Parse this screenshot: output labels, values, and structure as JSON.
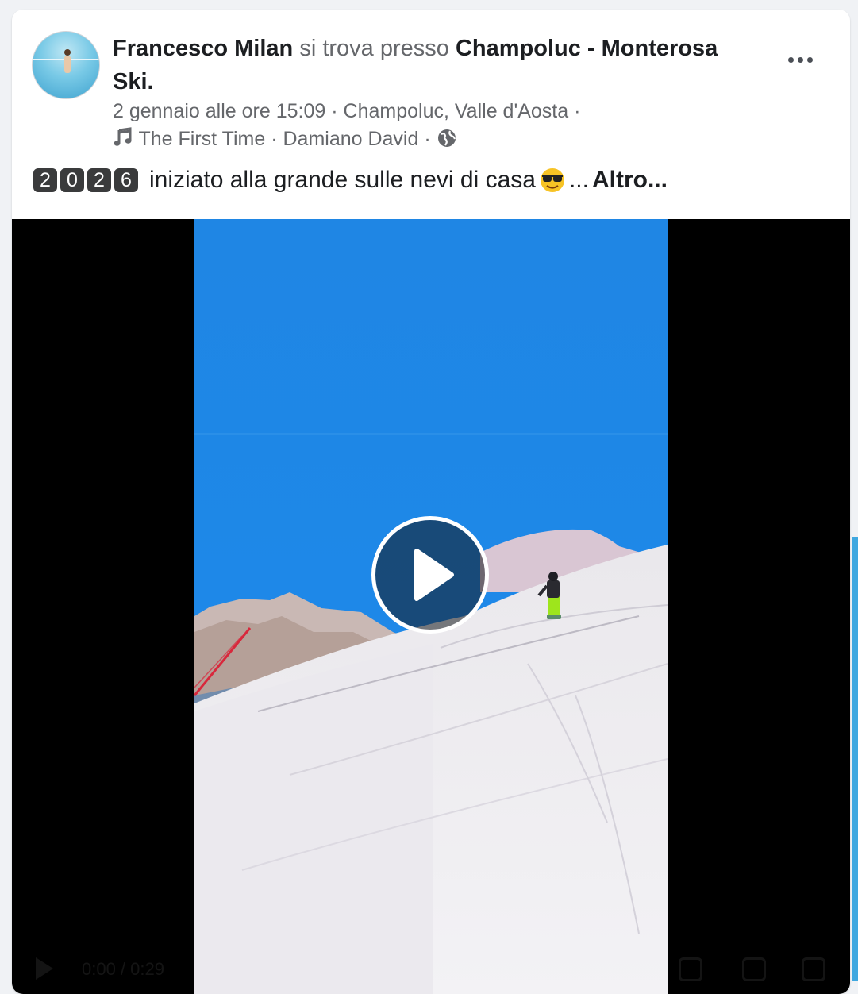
{
  "post": {
    "author_name": "Francesco Milan",
    "checkin_text": "si trova presso",
    "place_name": "Champoluc - Monterosa Ski.",
    "date": "2 gennaio alle ore 15:09",
    "separator": "·",
    "location": "Champoluc, Valle d'Aosta",
    "song_title": "The First Time",
    "song_artist": "Damiano David",
    "privacy_icon": "globe-icon",
    "more_icon": "more-options-icon",
    "caption": {
      "year_digits": [
        "2",
        "0",
        "2",
        "6"
      ],
      "text": "iniziato alla grande sulle nevi di casa",
      "emoji": "smiling-face-with-sunglasses",
      "ellipsis": "...",
      "more_link": "Altro..."
    }
  },
  "video": {
    "play_icon": "play-icon",
    "time": "0:00 / 0:29"
  },
  "colors": {
    "background": "#f0f2f5",
    "card": "#ffffff",
    "primary_text": "#1c1e21",
    "secondary_text": "#65676b",
    "sky": "#1e86e6",
    "video_bg": "#000000"
  }
}
